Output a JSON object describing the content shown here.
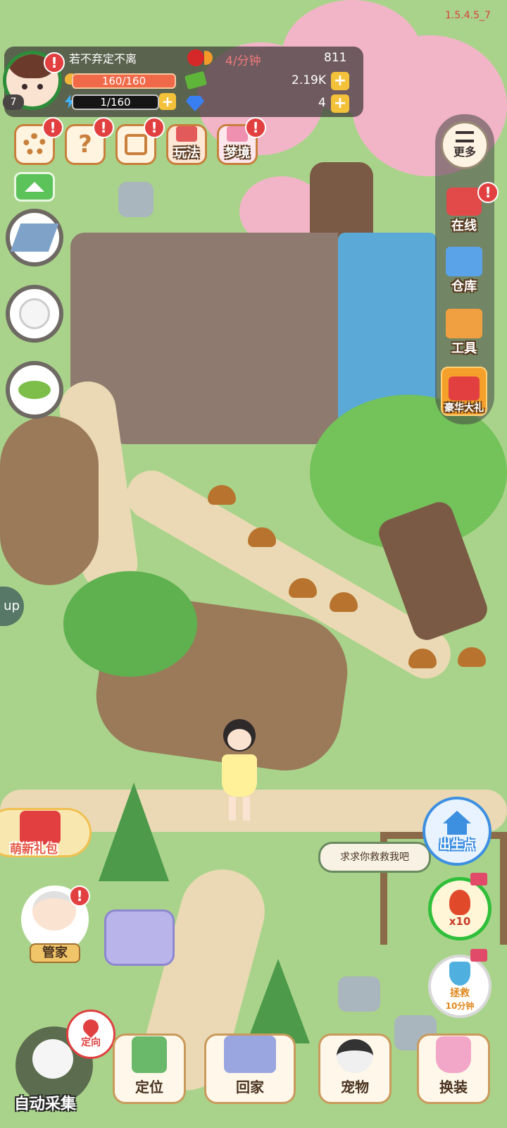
{
  "version": "1.5.4.5_7",
  "profile": {
    "name": "若不弃定不离",
    "level": "7",
    "hp": "160/160",
    "energy": "1/160"
  },
  "resources": {
    "rate": "4/分钟",
    "hearts": "811",
    "cash": "2.19K",
    "gems": "4"
  },
  "top_buttons": [
    {
      "label": ""
    },
    {
      "label": ""
    },
    {
      "label": ""
    },
    {
      "label": "玩法"
    },
    {
      "label": "梦境"
    }
  ],
  "right_menu": {
    "more": "更多",
    "online": "在线",
    "warehouse": "仓库",
    "tools": "工具",
    "gift": "豪华大礼"
  },
  "left_side": {
    "tab_partial": "up"
  },
  "gift_pack": "萌新礼包",
  "butler": "管家",
  "speech": "求求你救救我吧",
  "spawn": "出生点",
  "potion_count": "x10",
  "rescue": {
    "label_line1": "拯救",
    "label_line2": "10分钟"
  },
  "locate_small": "定向",
  "auto_collect": "自动采集",
  "bottom_nav": [
    {
      "label": "定位"
    },
    {
      "label": "回家"
    },
    {
      "label": "宠物"
    },
    {
      "label": "换装"
    }
  ],
  "colors": {
    "grass": "#a9d38a",
    "path": "#ead9b4",
    "hp_bar": "#f06a4a",
    "badge": "#e24040",
    "spawn_blue": "#3d8fe0"
  }
}
